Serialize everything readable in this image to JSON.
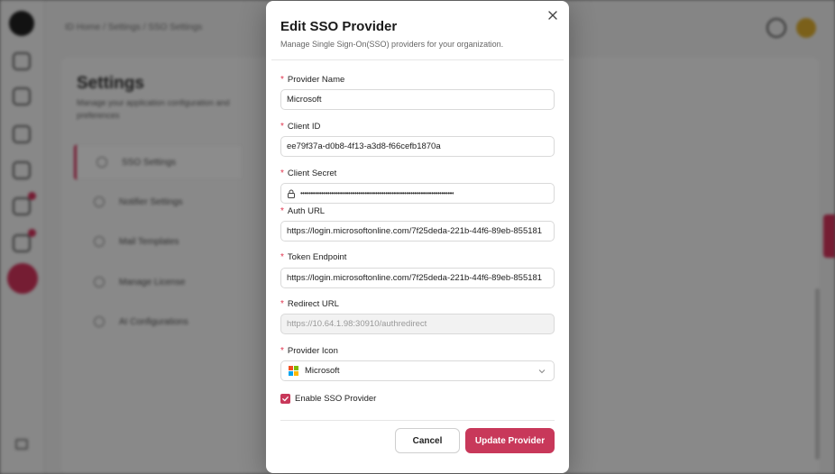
{
  "background": {
    "breadcrumb": "ID Home / Settings / SSO Settings",
    "settings_title": "Settings",
    "settings_desc": "Manage your application configuration and preferences",
    "settings_items": [
      {
        "label": "SSO Settings"
      },
      {
        "label": "Notifier Settings"
      },
      {
        "label": "Mail Templates"
      },
      {
        "label": "Manage License"
      },
      {
        "label": "AI Configurations"
      }
    ]
  },
  "modal": {
    "title": "Edit SSO Provider",
    "subtitle": "Manage Single Sign-On(SSO) providers for your organization.",
    "required_mark": "*",
    "fields": {
      "provider_name": {
        "label": "Provider Name",
        "value": "Microsoft"
      },
      "client_id": {
        "label": "Client ID",
        "value": "ee79f37a-d0b8-4f13-a3d8-f66cefb1870a"
      },
      "client_secret": {
        "label": "Client Secret",
        "value": "••••••••••••••••••••••••••••••••••••••••••••••••••••••••••••••••••••••••••"
      },
      "auth_url": {
        "label": "Auth URL",
        "value": "https://login.microsoftonline.com/7f25deda-221b-44f6-89eb-855181"
      },
      "token_endpoint": {
        "label": "Token Endpoint",
        "value": "https://login.microsoftonline.com/7f25deda-221b-44f6-89eb-855181"
      },
      "redirect_url": {
        "label": "Redirect URL",
        "value": "https://10.64.1.98:30910/authredirect"
      },
      "provider_icon": {
        "label": "Provider Icon",
        "value": "Microsoft"
      }
    },
    "enable_label": "Enable SSO Provider",
    "enable_checked": true,
    "cancel_label": "Cancel",
    "update_label": "Update Provider"
  },
  "colors": {
    "accent": "#c8385a",
    "required": "#e0364f",
    "ms_red": "#f25022",
    "ms_green": "#7fba00",
    "ms_blue": "#00a4ef",
    "ms_yellow": "#ffb900"
  },
  "icons": {
    "close": "close-icon",
    "lock": "lock-icon",
    "chevron": "chevron-down-icon",
    "check": "check-icon",
    "microsoft": "microsoft-logo-icon"
  }
}
